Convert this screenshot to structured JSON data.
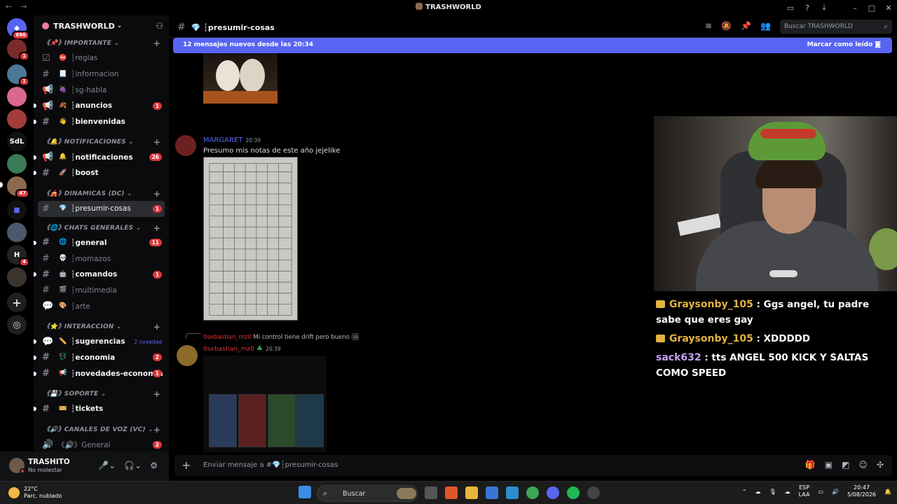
{
  "window": {
    "title": "TRASHWORLD"
  },
  "servers": [
    {
      "label": "",
      "badge": "696"
    },
    {
      "label": "",
      "badge": "1"
    },
    {
      "label": "",
      "badge": "1"
    },
    {
      "label": "",
      "badge": ""
    },
    {
      "label": "",
      "badge": ""
    },
    {
      "label": "SdL",
      "badge": ""
    },
    {
      "label": "",
      "badge": ""
    },
    {
      "label": "",
      "badge": "47"
    },
    {
      "label": "",
      "badge": ""
    },
    {
      "label": "",
      "badge": ""
    },
    {
      "label": "",
      "badge": "4"
    },
    {
      "label": "",
      "badge": ""
    }
  ],
  "guild": {
    "name": "TRASHWORLD"
  },
  "categories": {
    "importante": "《📌》IMPORTANTE",
    "notificaciones": "《🔔》NOTIFICACIONES",
    "dinamicas": "《🎪》DINAMICAS (DC)",
    "chats": "《🌐》CHATS GENERALES",
    "interaccion": "《⭐》INTERACCION",
    "soporte": "《💾》SOPORTE",
    "voz": "《🔊》CANALES DE VOZ (VC)"
  },
  "channels": {
    "reglas": {
      "name": "┆reglas",
      "emoji": "⛔"
    },
    "informacion": {
      "name": "┆informacion",
      "emoji": "📃"
    },
    "sghabla": {
      "name": "┆sg-habla",
      "emoji": "🍇"
    },
    "anuncios": {
      "name": "┆anuncios",
      "emoji": "🍂",
      "count": "1"
    },
    "bienvenidas": {
      "name": "┆bienvenidas",
      "emoji": "👋"
    },
    "notificaciones": {
      "name": "┆notificaciones",
      "emoji": "🔔",
      "count": "26"
    },
    "boost": {
      "name": "┆boost",
      "emoji": "🚀"
    },
    "presumir": {
      "name": "┆presumir-cosas",
      "emoji": "💎",
      "count": "1"
    },
    "general": {
      "name": "┆general",
      "emoji": "🌐",
      "count": "11"
    },
    "momazos": {
      "name": "┆momazos",
      "emoji": "💀"
    },
    "comandos": {
      "name": "┆comandos",
      "emoji": "🤖",
      "count": "1"
    },
    "multimedia": {
      "name": "┆multimedia",
      "emoji": "🎬"
    },
    "arte": {
      "name": "┆arte",
      "emoji": "🎨"
    },
    "sugerencias": {
      "name": "┆sugerencias",
      "emoji": "✏️",
      "novedad": "2 novedad"
    },
    "economia": {
      "name": "┆economia",
      "emoji": "💱",
      "count": "2"
    },
    "novedades": {
      "name": "┆novedades-economia",
      "emoji": "📢",
      "count": "1"
    },
    "tickets": {
      "name": "┆tickets",
      "emoji": "🎫"
    },
    "vcgeneral": {
      "name": "《🔊》General",
      "count": "2"
    }
  },
  "user": {
    "name": "TRASHITO",
    "status": "No molestar"
  },
  "header": {
    "channel": "┆presumir-cosas",
    "search_placeholder": "Buscar TRASHWORLD"
  },
  "banner": {
    "text": "12 mensajes nuevos desde las 20:34",
    "action": "Marcar como leído"
  },
  "messages": [
    {
      "author": "MARGARET",
      "time": "20:39",
      "text": "Presumo mis notas de este año jejelike"
    },
    {
      "reply_author": "0sebastian_mz0",
      "reply_text": "Mi control tiene drift pero bueno",
      "author": "0sebastian_mz0",
      "time": "20:39"
    }
  ],
  "composer": {
    "placeholder": "Enviar mensaje a #💎┆presumir-cosas"
  },
  "stream_chat": [
    {
      "user": "Graysonby_105",
      "text": ": Ggs angel, tu padre sabe que eres gay"
    },
    {
      "user": "Graysonby_105",
      "text": ": XDDDDD"
    },
    {
      "user": "sack632",
      "text": ": tts ANGEL 500 KICK Y SALTAS COMO SPEED"
    }
  ],
  "taskbar": {
    "temp": "22°C",
    "weather": "Parc. nublado",
    "search": "Buscar",
    "lang": "ESP",
    "lang2": "LAA",
    "time": "20:47",
    "date": "5/08/2026"
  }
}
